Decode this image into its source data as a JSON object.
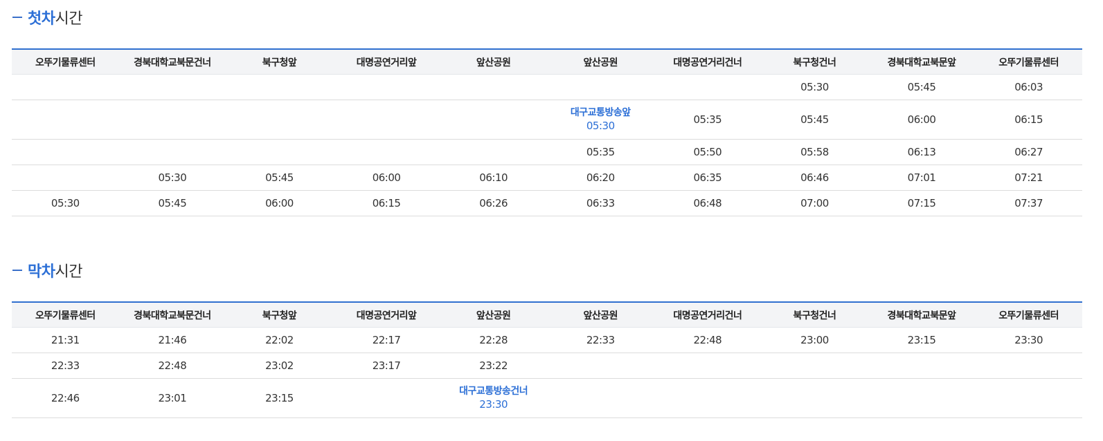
{
  "sections": [
    {
      "title_accent": "첫차",
      "title_rest": "시간",
      "headers": [
        "오뚜기물류센터",
        "경북대학교북문건너",
        "북구청앞",
        "대명공연거리앞",
        "앞산공원",
        "앞산공원",
        "대명공연거리건너",
        "북구청건너",
        "경북대학교북문앞",
        "오뚜기물류센터"
      ],
      "rows": [
        {
          "cells": [
            "",
            "",
            "",
            "",
            "",
            "",
            "",
            "05:30",
            "05:45",
            "06:03"
          ]
        },
        {
          "cells": [
            "",
            "",
            "",
            "",
            "",
            {
              "note": "대구교통방송앞",
              "time": "05:30"
            },
            "05:35",
            "05:45",
            "06:00",
            "06:15"
          ]
        },
        {
          "cells": [
            "",
            "",
            "",
            "",
            "",
            "05:35",
            "05:50",
            "05:58",
            "06:13",
            "06:27"
          ]
        },
        {
          "cells": [
            "",
            "05:30",
            "05:45",
            "06:00",
            "06:10",
            "06:20",
            "06:35",
            "06:46",
            "07:01",
            "07:21"
          ]
        },
        {
          "cells": [
            "05:30",
            "05:45",
            "06:00",
            "06:15",
            "06:26",
            "06:33",
            "06:48",
            "07:00",
            "07:15",
            "07:37"
          ]
        }
      ]
    },
    {
      "title_accent": "막차",
      "title_rest": "시간",
      "headers": [
        "오뚜기물류센터",
        "경북대학교북문건너",
        "북구청앞",
        "대명공연거리앞",
        "앞산공원",
        "앞산공원",
        "대명공연거리건너",
        "북구청건너",
        "경북대학교북문앞",
        "오뚜기물류센터"
      ],
      "rows": [
        {
          "cells": [
            "21:31",
            "21:46",
            "22:02",
            "22:17",
            "22:28",
            "22:33",
            "22:48",
            "23:00",
            "23:15",
            "23:30"
          ]
        },
        {
          "cells": [
            "22:33",
            "22:48",
            "23:02",
            "23:17",
            "23:22",
            "",
            "",
            "",
            "",
            ""
          ]
        },
        {
          "cells": [
            "22:46",
            "23:01",
            "23:15",
            "",
            {
              "note": "대구교통방송건너",
              "time": "23:30"
            },
            "",
            "",
            "",
            "",
            ""
          ]
        }
      ]
    }
  ]
}
